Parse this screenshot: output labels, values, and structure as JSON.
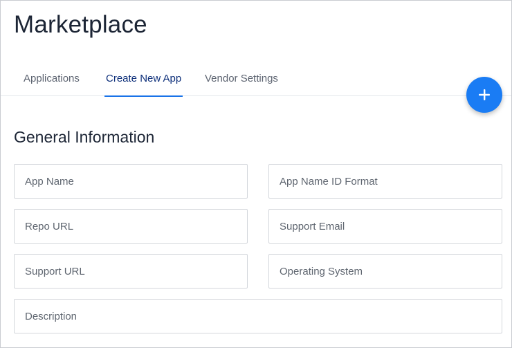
{
  "header": {
    "title": "Marketplace"
  },
  "tabs": [
    {
      "label": "Applications",
      "active": false
    },
    {
      "label": "Create New App",
      "active": true
    },
    {
      "label": "Vendor Settings",
      "active": false
    }
  ],
  "fab": {
    "icon": "plus-icon",
    "color": "#1a7cf4"
  },
  "section": {
    "title": "General Information"
  },
  "form": {
    "app_name": {
      "placeholder": "App Name",
      "value": ""
    },
    "app_name_id_format": {
      "placeholder": "App Name ID Format",
      "value": ""
    },
    "repo_url": {
      "placeholder": "Repo URL",
      "value": ""
    },
    "support_email": {
      "placeholder": "Support Email",
      "value": ""
    },
    "support_url": {
      "placeholder": "Support URL",
      "value": ""
    },
    "operating_system": {
      "placeholder": "Operating System",
      "value": ""
    },
    "description": {
      "placeholder": "Description",
      "value": ""
    }
  },
  "colors": {
    "accent": "#1a73e8",
    "active_tab_text": "#0d2f7a"
  }
}
